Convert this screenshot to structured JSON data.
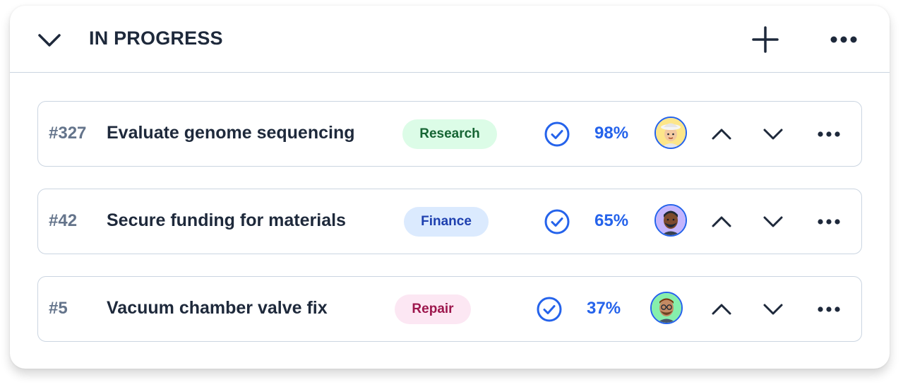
{
  "section": {
    "title": "IN PROGRESS",
    "icons": {
      "collapse": "chevron-down-icon",
      "add": "plus-icon",
      "more": "more-horizontal-icon"
    }
  },
  "tasks": [
    {
      "id": "#327",
      "title": "Evaluate genome sequencing",
      "tag": "Research",
      "tag_colors": {
        "bg": "#dcfce7",
        "fg": "#166534"
      },
      "progress": "98%",
      "progress_value": 0.98,
      "avatar_icon": "avatar-woman-hat-icon",
      "avatar_bg": "#fde68a"
    },
    {
      "id": "#42",
      "title": "Secure funding for materials",
      "tag": "Finance",
      "tag_colors": {
        "bg": "#dbeafe",
        "fg": "#1e40af"
      },
      "progress": "65%",
      "progress_value": 0.65,
      "avatar_icon": "avatar-man-beard-icon",
      "avatar_bg": "#c4b5fd"
    },
    {
      "id": "#5",
      "title": "Vacuum chamber valve fix",
      "tag": "Repair",
      "tag_colors": {
        "bg": "#fce7f3",
        "fg": "#9d174d"
      },
      "progress": "37%",
      "progress_value": 0.37,
      "avatar_icon": "avatar-man-glasses-icon",
      "avatar_bg": "#86efac"
    }
  ],
  "colors": {
    "accent": "#2563eb",
    "text_dark": "#1e293b",
    "text_muted": "#64748b",
    "border": "#cbd5e1"
  }
}
